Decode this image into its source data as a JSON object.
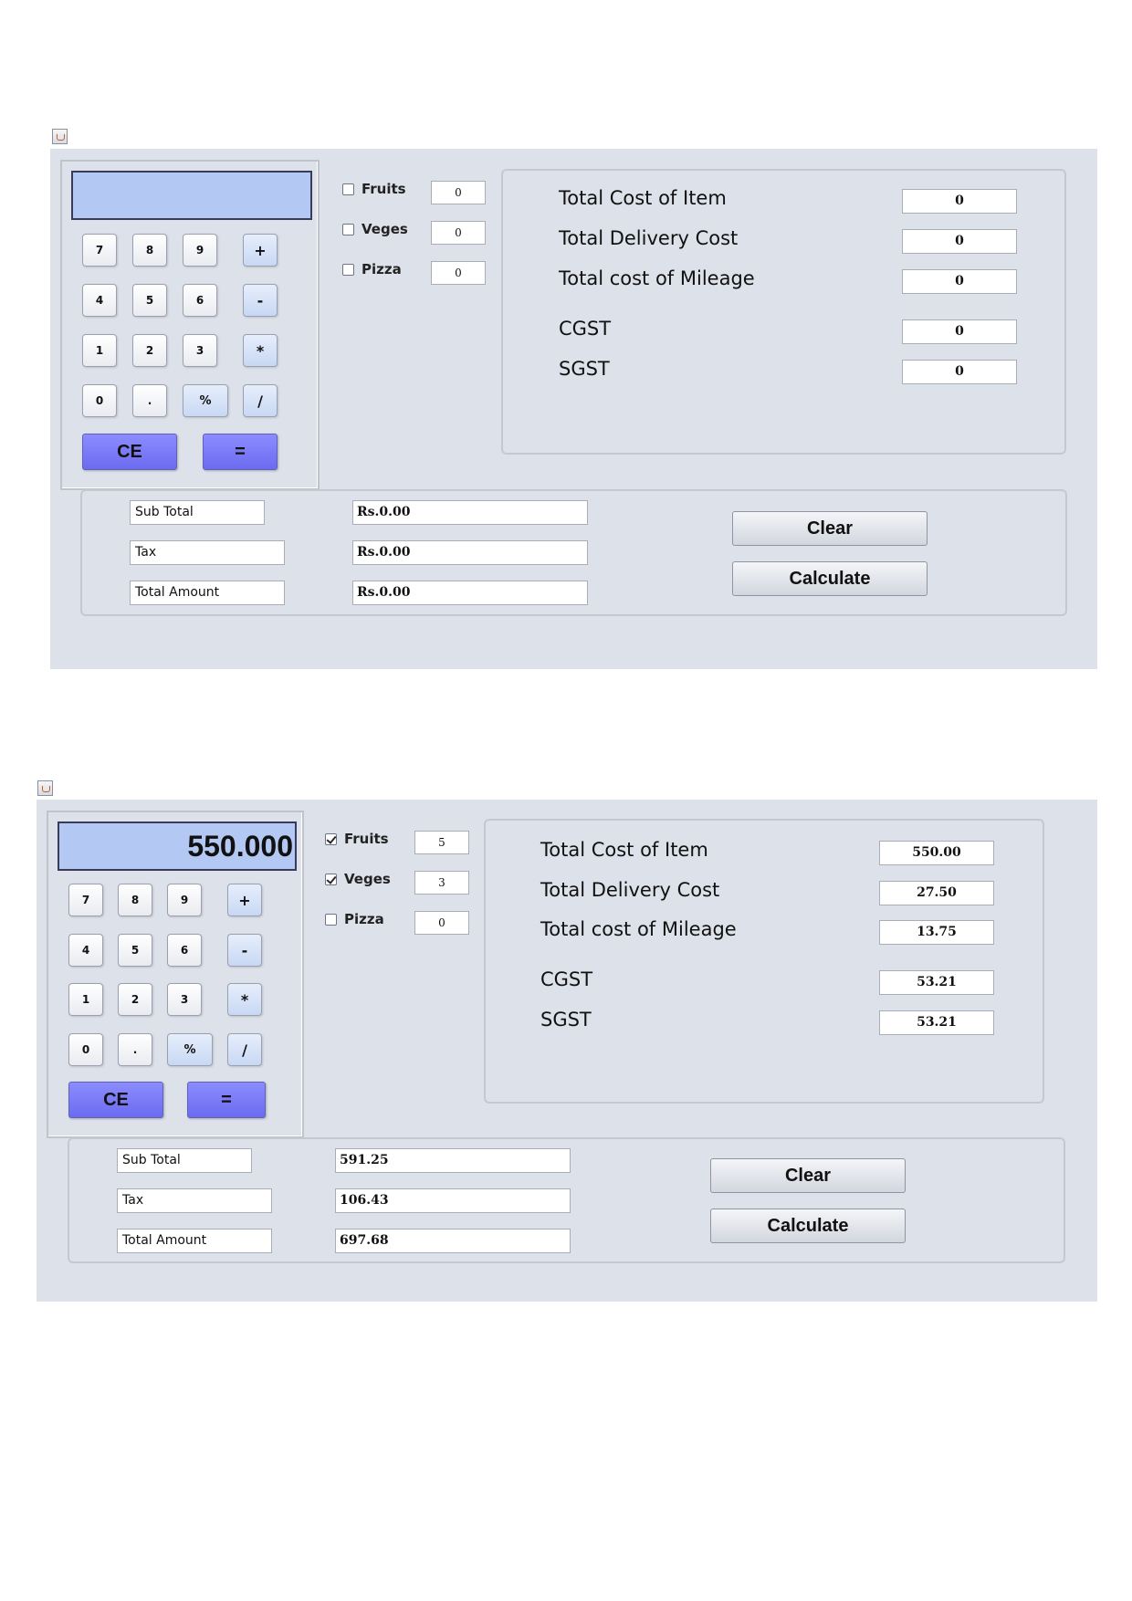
{
  "screens": [
    {
      "display": "",
      "keys": [
        "7",
        "8",
        "9",
        "+",
        "4",
        "5",
        "6",
        "-",
        "1",
        "2",
        "3",
        "*",
        "0",
        ".",
        "%",
        "/"
      ],
      "ce_label": "CE",
      "eq_label": "=",
      "items": [
        {
          "label": "Fruits",
          "checked": false,
          "qty": "0"
        },
        {
          "label": "Veges",
          "checked": false,
          "qty": "0"
        },
        {
          "label": "Pizza",
          "checked": false,
          "qty": "0"
        }
      ],
      "costs": [
        {
          "label": "Total Cost of Item",
          "value": "0"
        },
        {
          "label": "Total Delivery Cost",
          "value": "0"
        },
        {
          "label": "Total cost of Mileage",
          "value": "0"
        },
        {
          "label": "CGST",
          "value": "0"
        },
        {
          "label": "SGST",
          "value": "0"
        }
      ],
      "summary": [
        {
          "label": "Sub Total",
          "value": "Rs.0.00"
        },
        {
          "label": "Tax",
          "value": "Rs.0.00"
        },
        {
          "label": "Total Amount",
          "value": "Rs.0.00"
        }
      ],
      "clear_label": "Clear",
      "calculate_label": "Calculate"
    },
    {
      "display": "550.000",
      "keys": [
        "7",
        "8",
        "9",
        "+",
        "4",
        "5",
        "6",
        "-",
        "1",
        "2",
        "3",
        "*",
        "0",
        ".",
        "%",
        "/"
      ],
      "ce_label": "CE",
      "eq_label": "=",
      "items": [
        {
          "label": "Fruits",
          "checked": true,
          "qty": "5"
        },
        {
          "label": "Veges",
          "checked": true,
          "qty": "3"
        },
        {
          "label": "Pizza",
          "checked": false,
          "qty": "0"
        }
      ],
      "costs": [
        {
          "label": "Total Cost of Item",
          "value": "550.00"
        },
        {
          "label": "Total Delivery Cost",
          "value": "27.50"
        },
        {
          "label": "Total cost of Mileage",
          "value": "13.75"
        },
        {
          "label": "CGST",
          "value": "53.21"
        },
        {
          "label": "SGST",
          "value": "53.21"
        }
      ],
      "summary": [
        {
          "label": "Sub Total",
          "value": "591.25"
        },
        {
          "label": "Tax",
          "value": "106.43"
        },
        {
          "label": "Total Amount",
          "value": "697.68"
        }
      ],
      "clear_label": "Clear",
      "calculate_label": "Calculate"
    }
  ],
  "icons": {
    "window": "java-app-icon",
    "checkbox": "checkbox-icon"
  },
  "colors": {
    "window_bg": "#dde1e9",
    "display_bg": "#b4c8f4",
    "big_key": "#7b7bf6"
  }
}
